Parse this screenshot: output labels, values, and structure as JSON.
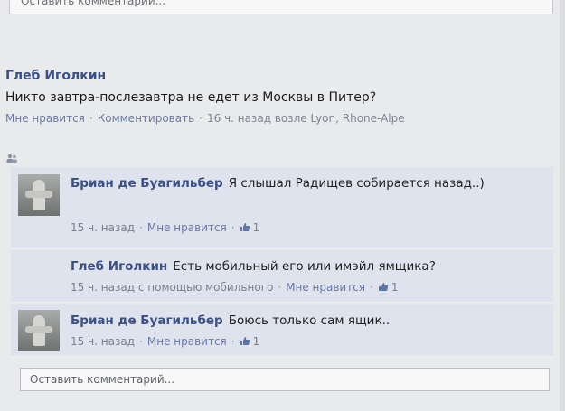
{
  "top_comment_box": {
    "placeholder": "Оставить комментарий..."
  },
  "post": {
    "author": "Глеб Иголкин",
    "text": "Никто завтра-послезавтра не едет из Москвы в Питер?",
    "actions": {
      "like": "Мне нравится",
      "comment": "Комментировать",
      "time": "16 ч. назад возле Lyon, Rhone-Alpe"
    }
  },
  "comments": [
    {
      "author": "Бриан де Буагильбер",
      "text": "Я слышал Радищев собирается назад..)",
      "time": "15 ч. назад",
      "like": "Мне нравится",
      "like_count": "1",
      "has_avatar": true
    },
    {
      "author": "Глеб Иголкин",
      "text": "Есть мобильный его или имэйл ямщика?",
      "time": "15 ч. назад с помощью мобильного",
      "like": "Мне нравится",
      "like_count": "1",
      "has_avatar": false
    },
    {
      "author": "Бриан де Буагильбер",
      "text": "Боюсь только сам ящик..",
      "time": "15 ч. назад",
      "like": "Мне нравится",
      "like_count": "1",
      "has_avatar": true
    }
  ],
  "comment_box": {
    "placeholder": "Оставить комментарий..."
  },
  "colors": {
    "name": "#3b4f86",
    "link": "#6b7aa6",
    "comment_bg": "#dfe3ee"
  }
}
